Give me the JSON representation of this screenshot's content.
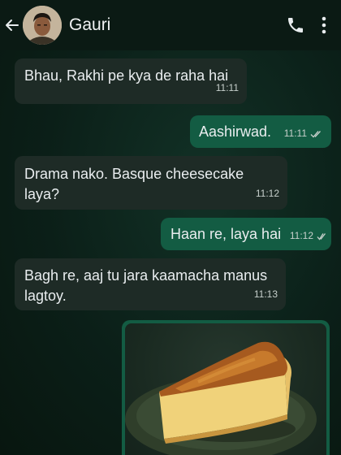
{
  "header": {
    "contact_name": "Gauri",
    "back_icon": "arrow-left-icon",
    "call_icon": "phone-icon",
    "menu_icon": "more-vertical-icon"
  },
  "messages": [
    {
      "direction": "in",
      "text": "Bhau, Rakhi pe kya de raha hai",
      "time": "11:11"
    },
    {
      "direction": "out",
      "text": "Aashirwad.",
      "time": "11:11",
      "status": "read"
    },
    {
      "direction": "in",
      "text": "Drama nako. Basque cheesecake laya?",
      "time": "11:12"
    },
    {
      "direction": "out",
      "text": "Haan re, laya hai",
      "time": "11:12",
      "status": "read"
    },
    {
      "direction": "in",
      "text": "Bagh re, aaj tu jara kaamacha manus lagtoy.",
      "time": "11:13"
    }
  ],
  "image_message": {
    "direction": "out",
    "content": "basque-cheesecake-slice-photo"
  },
  "colors": {
    "header_bg": "#0b1a14",
    "incoming_bubble": "#1e2b26",
    "outgoing_bubble": "#135c43",
    "chat_bg": "#0b1f18",
    "text": "#e9edef"
  }
}
